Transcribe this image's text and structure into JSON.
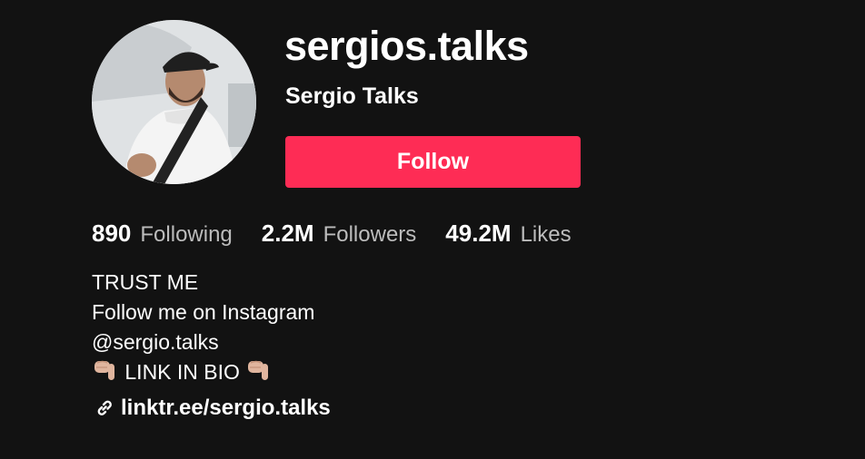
{
  "profile": {
    "username": "sergios.talks",
    "nickname": "Sergio Talks",
    "avatar_icon": "profile-photo",
    "follow_label": "Follow",
    "accent_color": "#fe2c55"
  },
  "stats": [
    {
      "count": "890",
      "label": "Following"
    },
    {
      "count": "2.2M",
      "label": "Followers"
    },
    {
      "count": "49.2M",
      "label": "Likes"
    }
  ],
  "bio": {
    "line1": "TRUST ME",
    "line2": "Follow me on Instagram",
    "line3": "@sergio.talks",
    "line4_text": "LINK IN BIO",
    "line4_icon": "pointing-down-emoji"
  },
  "link": {
    "icon": "link-icon",
    "text": "linktr.ee/sergio.talks"
  }
}
